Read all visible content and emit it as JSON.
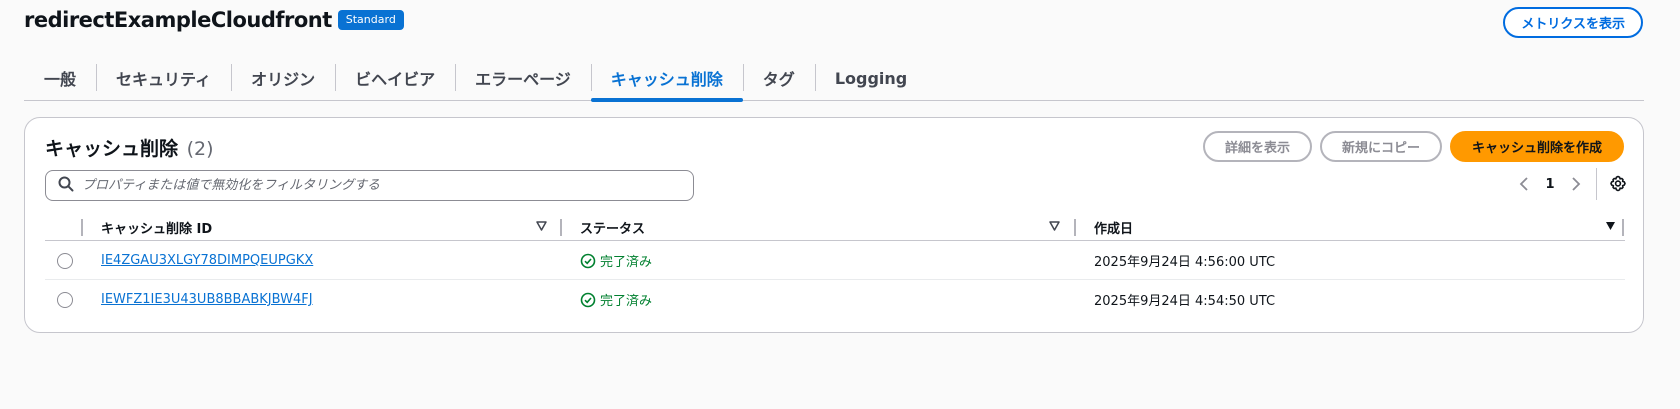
{
  "header": {
    "title": "redirectExampleCloudfront",
    "badge": "Standard",
    "metrics_button": "メトリクスを表示"
  },
  "tabs": [
    {
      "label": "一般",
      "active": false
    },
    {
      "label": "セキュリティ",
      "active": false
    },
    {
      "label": "オリジン",
      "active": false
    },
    {
      "label": "ビヘイビア",
      "active": false
    },
    {
      "label": "エラーページ",
      "active": false
    },
    {
      "label": "キャッシュ削除",
      "active": true
    },
    {
      "label": "タグ",
      "active": false
    },
    {
      "label": "Logging",
      "active": false
    }
  ],
  "panel": {
    "title": "キャッシュ削除",
    "count": "(2)",
    "buttons": {
      "details": "詳細を表示",
      "copy": "新規にコピー",
      "create": "キャッシュ削除を作成"
    },
    "search_placeholder": "プロパティまたは値で無効化をフィルタリングする",
    "pager": {
      "page": "1"
    }
  },
  "table": {
    "columns": [
      "キャッシュ削除 ID",
      "ステータス",
      "作成日"
    ],
    "rows": [
      {
        "id": "IE4ZGAU3XLGY78DIMPQEUPGKX",
        "status": "完了済み",
        "created": "2025年9月24日 4:56:00 UTC"
      },
      {
        "id": "IEWFZ1IE3U43UB8BBABKJBW4FJ",
        "status": "完了済み",
        "created": "2025年9月24日 4:54:50 UTC"
      }
    ]
  },
  "colors": {
    "accent": "#0972d3",
    "primary_button": "#ff9900",
    "success": "#00802f"
  }
}
